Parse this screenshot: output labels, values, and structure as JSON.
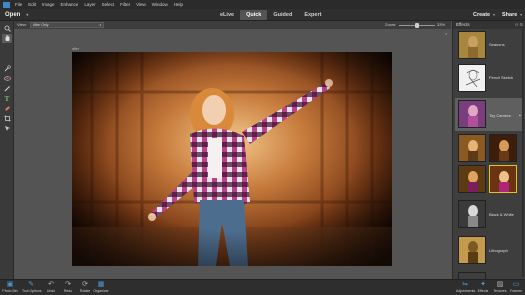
{
  "menu": [
    "File",
    "Edit",
    "Image",
    "Enhance",
    "Layer",
    "Select",
    "Filter",
    "View",
    "Window",
    "Help"
  ],
  "open_label": "Open",
  "modes": [
    "eLive",
    "Quick",
    "Guided",
    "Expert"
  ],
  "active_mode": "Quick",
  "create_label": "Create",
  "share_label": "Share",
  "options": {
    "view_label": "View:",
    "view_value": "After Only",
    "zoom_label": "Zoom:",
    "zoom_value": "33%",
    "zoom_level": 0.33
  },
  "document": {
    "tab_label": "after",
    "close": "×"
  },
  "tools": [
    "zoom-icon",
    "hand-icon",
    "quick-selection-icon",
    "red-eye-icon",
    "whiten-teeth-icon",
    "type-icon",
    "spot-healing-icon",
    "crop-icon",
    "move-icon"
  ],
  "panel": {
    "title": "Effects",
    "items": [
      {
        "label": "Seasons"
      },
      {
        "label": "Pencil Sketch"
      },
      {
        "label": "Toy Camera"
      },
      {
        "label": "Black & White"
      },
      {
        "label": "Lithograph"
      }
    ]
  },
  "bottom_left": [
    {
      "label": "Photo Bin",
      "icon": "photo-bin-icon"
    },
    {
      "label": "Tool Options",
      "icon": "tool-options-icon"
    },
    {
      "label": "Undo",
      "icon": "undo-icon"
    },
    {
      "label": "Redo",
      "icon": "redo-icon"
    },
    {
      "label": "Rotate",
      "icon": "rotate-icon"
    },
    {
      "label": "Organizer",
      "icon": "organizer-icon"
    }
  ],
  "bottom_right": [
    {
      "label": "Adjustments",
      "icon": "adjustments-icon"
    },
    {
      "label": "Effects",
      "icon": "effects-icon"
    },
    {
      "label": "Textures",
      "icon": "textures-icon"
    },
    {
      "label": "Frames",
      "icon": "frames-icon"
    }
  ],
  "colors": {
    "accent": "#4b9ad8",
    "highlight": "#e3c02a",
    "panel_bg": "#3e3e3e"
  }
}
